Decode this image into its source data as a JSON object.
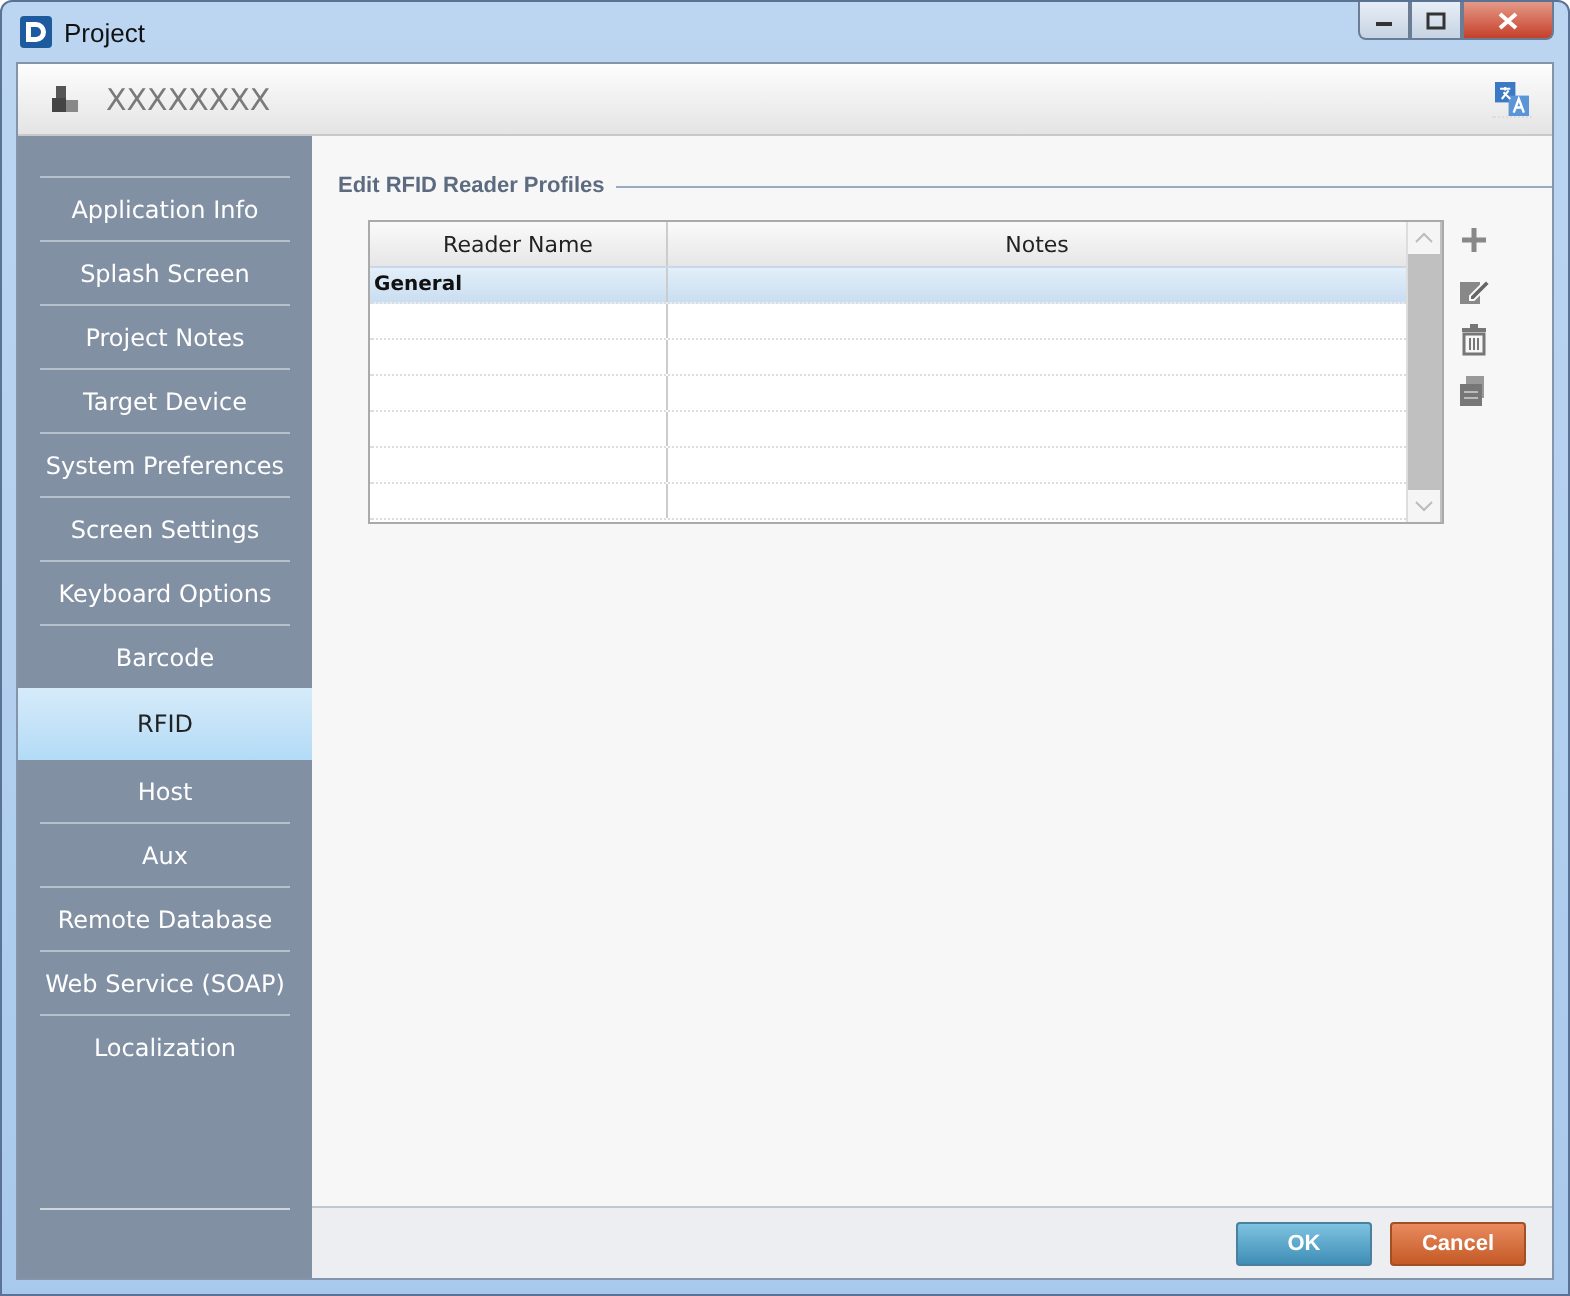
{
  "window": {
    "title": "Project"
  },
  "header": {
    "title": "XXXXXXXX"
  },
  "sidebar": {
    "items": [
      {
        "label": "Application Info",
        "selected": false
      },
      {
        "label": "Splash Screen",
        "selected": false
      },
      {
        "label": "Project Notes",
        "selected": false
      },
      {
        "label": "Target Device",
        "selected": false
      },
      {
        "label": "System Preferences",
        "selected": false
      },
      {
        "label": "Screen Settings",
        "selected": false
      },
      {
        "label": "Keyboard Options",
        "selected": false
      },
      {
        "label": "Barcode",
        "selected": false
      },
      {
        "label": "RFID",
        "selected": true
      },
      {
        "label": "Host",
        "selected": false
      },
      {
        "label": "Aux",
        "selected": false
      },
      {
        "label": "Remote Database",
        "selected": false
      },
      {
        "label": "Web Service (SOAP)",
        "selected": false
      },
      {
        "label": "Localization",
        "selected": false
      }
    ]
  },
  "section": {
    "title": "Edit RFID Reader Profiles"
  },
  "table": {
    "columns": [
      "Reader Name",
      "Notes"
    ],
    "rows": [
      {
        "reader_name": "General",
        "selected": true
      }
    ]
  },
  "buttons": [
    {
      "label": "OK",
      "kind": "primary"
    },
    {
      "label": "Cancel",
      "kind": "cancel"
    }
  ]
}
